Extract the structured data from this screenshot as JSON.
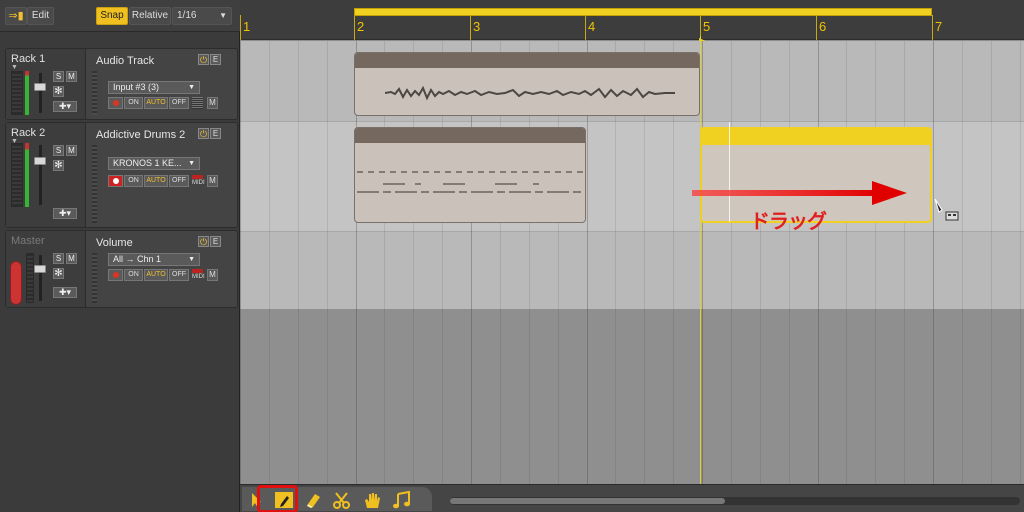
{
  "toolbar_top": {
    "edit_label": "Edit",
    "snap_label": "Snap",
    "relative_label": "Relative",
    "grid_value": "1/16"
  },
  "racks": [
    {
      "rack_name": "Rack 1",
      "track_title": "Audio Track",
      "input": "Input #3 (3)",
      "s": "S",
      "m": "M",
      "pwr": "⏻",
      "e": "E",
      "on": "ON",
      "auto": "AUTO",
      "off": "OFF",
      "midi_m": "M"
    },
    {
      "rack_name": "Rack 2",
      "track_title": "Addictive Drums 2",
      "input": "KRONOS 1 KE...",
      "s": "S",
      "m": "M",
      "pwr": "⏻",
      "e": "E",
      "on": "ON",
      "auto": "AUTO",
      "off": "OFF",
      "midi_label": "MIDI",
      "midi_m": "M"
    },
    {
      "rack_name": "Master",
      "track_title": "Volume",
      "input": "All → Chn 1",
      "s": "S",
      "m": "M",
      "pwr": "⏻",
      "e": "E",
      "on": "ON",
      "auto": "AUTO",
      "off": "OFF",
      "midi_label": "MIDI",
      "midi_m": "M"
    }
  ],
  "ruler": {
    "bars": [
      "1",
      "2",
      "3",
      "4",
      "5",
      "6",
      "7"
    ]
  },
  "annotation": {
    "drag_text": "ドラッグ",
    "arrow_color": "#e01010"
  },
  "tools": [
    "arrow-icon",
    "pencil-icon",
    "eraser-icon",
    "scissors-icon",
    "hand-icon",
    "note-icon"
  ],
  "colors": {
    "accent": "#f0c020",
    "highlight": "#e01010"
  }
}
